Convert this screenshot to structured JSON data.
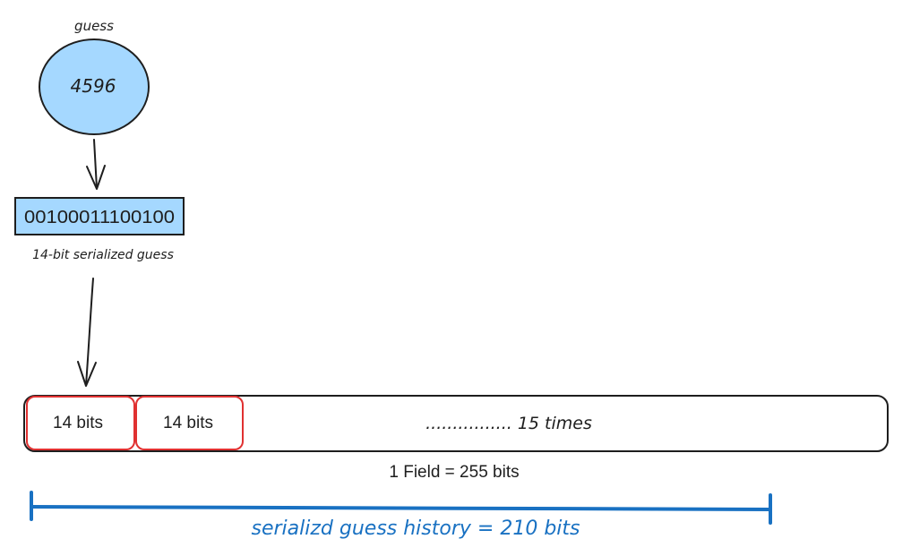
{
  "guess": {
    "label": "guess",
    "value": "4596"
  },
  "serialized": {
    "bits": "00100011100100",
    "caption": "14-bit serialized guess"
  },
  "field": {
    "slot_1": "14 bits",
    "slot_2": "14 bits",
    "repeat_text": "................ 15 times",
    "caption": "1 Field = 255 bits"
  },
  "history": {
    "label": "serializd guess history = 210 bits"
  },
  "colors": {
    "node_fill": "#a5d8ff",
    "stroke": "#1e1e1e",
    "slot_stroke": "#e03131",
    "history": "#1971c2"
  }
}
